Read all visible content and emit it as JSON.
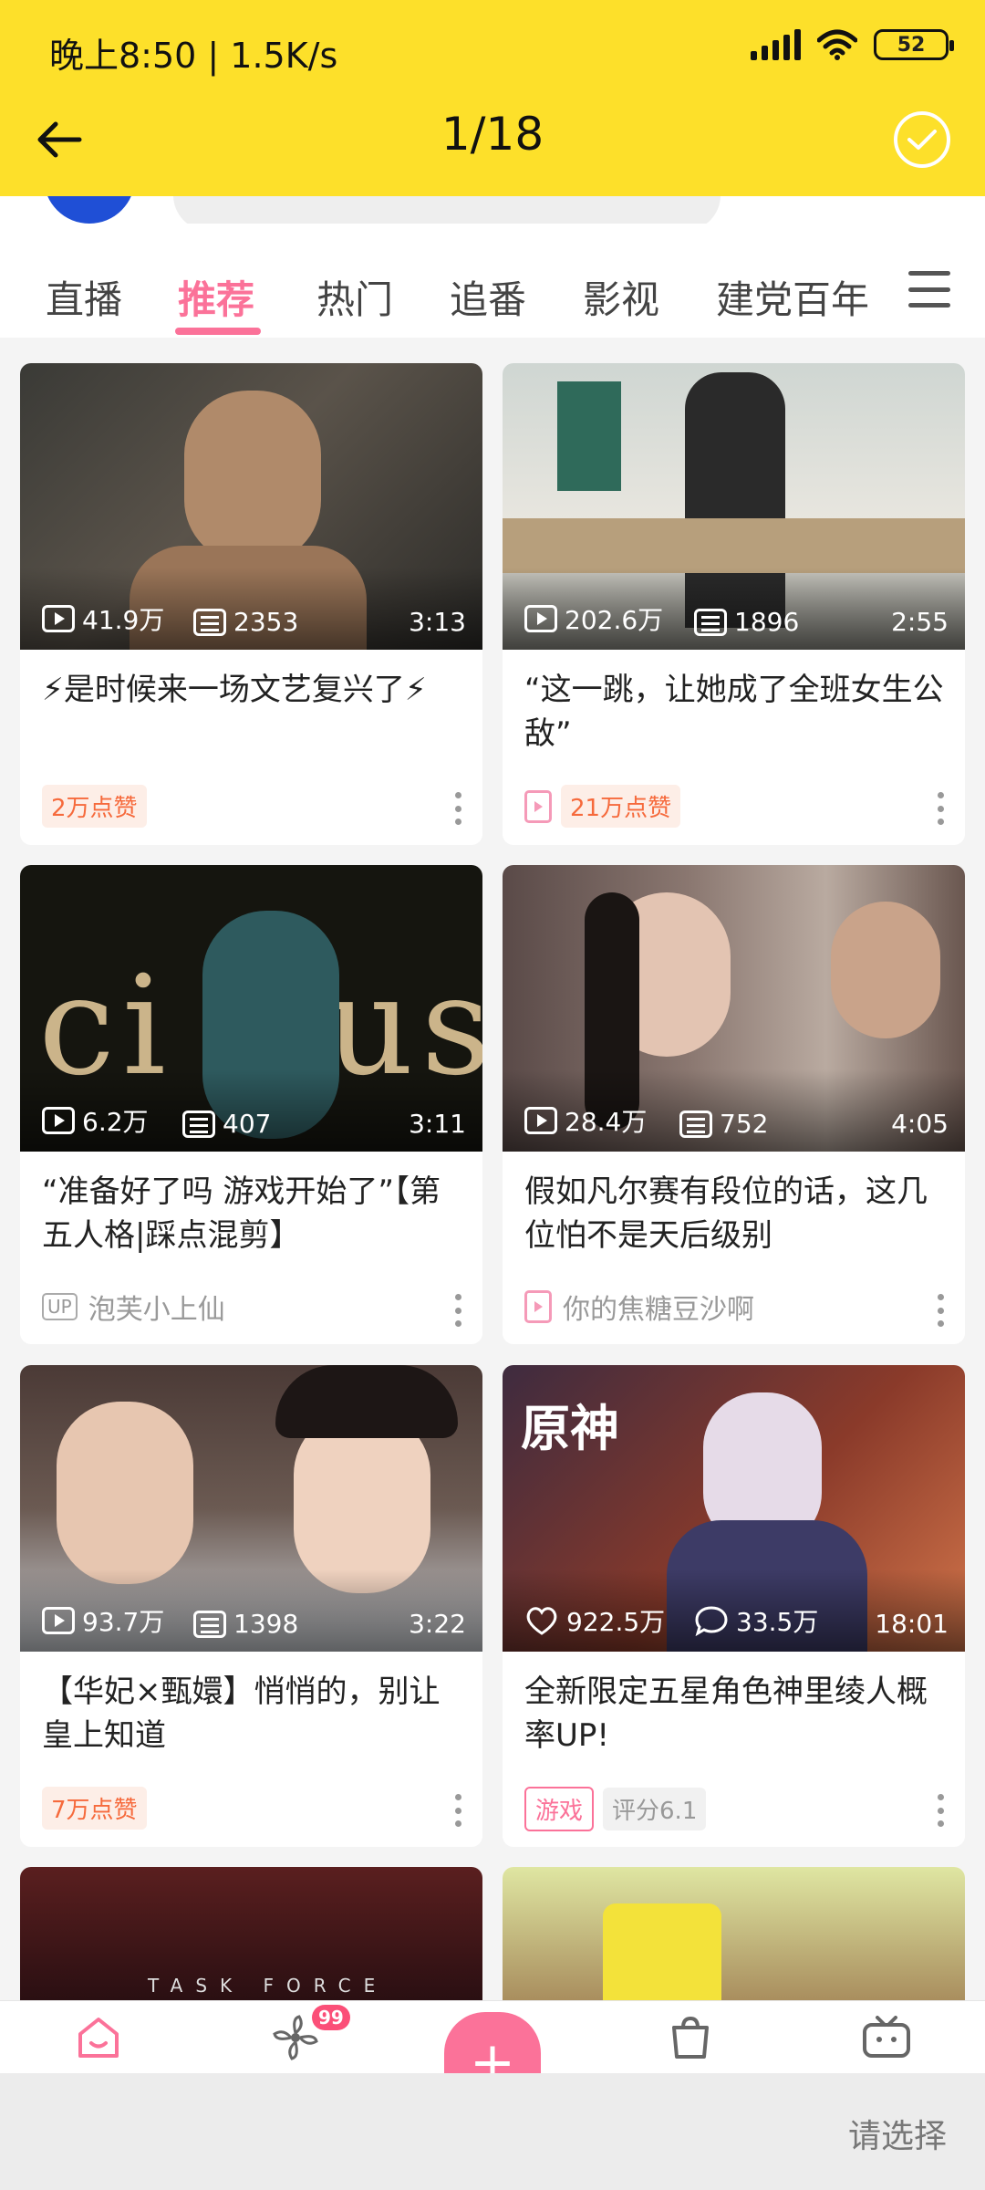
{
  "status_bar": {
    "time_speed": "晚上8:50 | 1.5K/s",
    "battery": "52"
  },
  "header": {
    "page_counter": "1/18"
  },
  "tabs": [
    {
      "label": "直播",
      "active": false
    },
    {
      "label": "推荐",
      "active": true
    },
    {
      "label": "热门",
      "active": false
    },
    {
      "label": "追番",
      "active": false
    },
    {
      "label": "影视",
      "active": false
    },
    {
      "label": "建党百年",
      "active": false
    }
  ],
  "cards": [
    {
      "views": "41.9万",
      "danmaku": "2353",
      "duration": "3:13",
      "title": "⚡是时候来一场文艺复兴了⚡",
      "like_tag": "2万点赞"
    },
    {
      "views": "202.6万",
      "danmaku": "1896",
      "duration": "2:55",
      "title": "“这一跳，让她成了全班女生公敌”",
      "like_tag": "21万点赞"
    },
    {
      "views": "6.2万",
      "danmaku": "407",
      "duration": "3:11",
      "title": "“准备好了吗 游戏开始了”【第五人格|踩点混剪】",
      "uploader": "泡芙小上仙",
      "up_label": "UP"
    },
    {
      "views": "28.4万",
      "danmaku": "752",
      "duration": "4:05",
      "title": "假如凡尔赛有段位的话，这几位怕不是天后级别",
      "uploader": "你的焦糖豆沙啊"
    },
    {
      "views": "93.7万",
      "danmaku": "1398",
      "duration": "3:22",
      "title": "【华妃×甄嬛】悄悄的，别让皇上知道",
      "like_tag": "7万点赞"
    },
    {
      "likes": "922.5万",
      "comments": "33.5万",
      "duration": "18:01",
      "title": "全新限定五星角色神里绫人概率UP!",
      "game_tag": "游戏",
      "score_tag": "评分6.1",
      "thumb_logo": "原神"
    }
  ],
  "partial_thumb_text": "TASK FORCE",
  "bottom_nav": {
    "badge": "99",
    "plus": "+"
  },
  "sheet": {
    "select_label": "请选择"
  },
  "colors": {
    "accent": "#fb7299",
    "header_bg": "#fde02a"
  }
}
